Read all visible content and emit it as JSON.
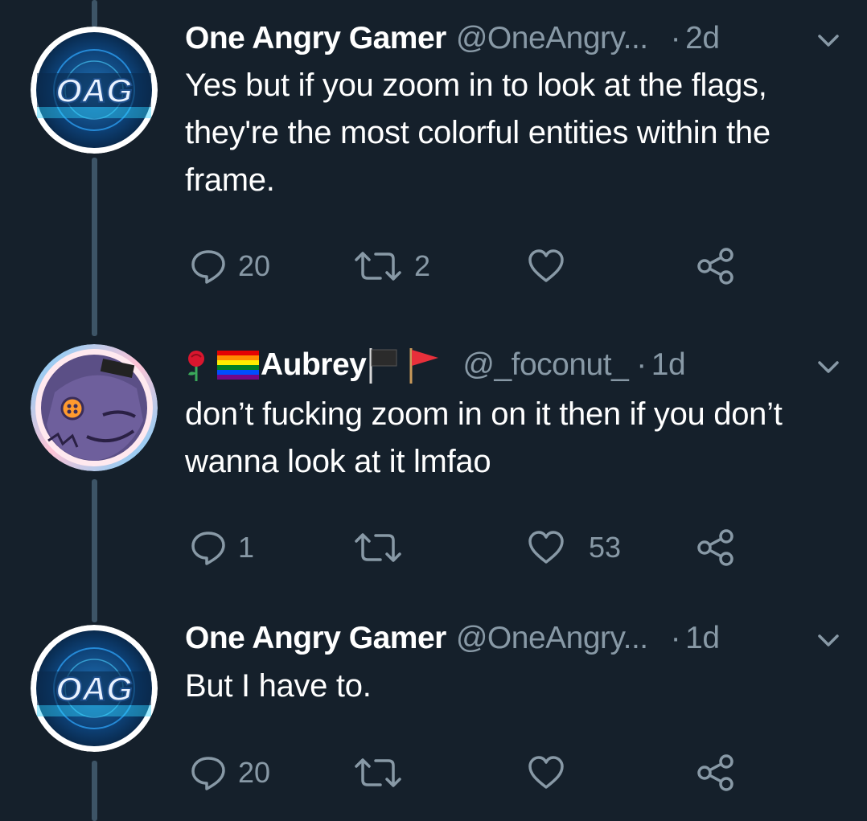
{
  "tweets": [
    {
      "name": "One Angry Gamer",
      "handle": "@OneAngry...",
      "separator": "·",
      "time": "2d",
      "text": "Yes but if you zoom in to look at the flags, they're the most colorful entities within the frame.",
      "replies": "20",
      "retweets": "2",
      "likes": "",
      "avatar_label": "OAG"
    },
    {
      "name": "Aubrey",
      "handle": "@_foconut_",
      "separator": "·",
      "time": "1d",
      "text": "don’t fucking zoom in on it then if you don’t wanna look at it lmfao",
      "replies": "1",
      "retweets": "",
      "likes": "53",
      "name_emoji_before": [
        "rose-emoji",
        "rainbow-flag-emoji"
      ],
      "name_emoji_after": [
        "black-flag-emoji",
        "triangular-flag-emoji"
      ]
    },
    {
      "name": "One Angry Gamer",
      "handle": "@OneAngry...",
      "separator": "·",
      "time": "1d",
      "text": "But I have to.",
      "replies": "20",
      "retweets": "",
      "likes": "",
      "avatar_label": "OAG"
    }
  ],
  "icons": {
    "reply": "reply-icon",
    "retweet": "retweet-icon",
    "like": "heart-icon",
    "share": "share-icon",
    "more": "chevron-down-icon"
  },
  "colors": {
    "background": "#15202b",
    "secondary_text": "#8899a6",
    "thread_line": "#3d5466",
    "primary_text": "#ffffff"
  }
}
